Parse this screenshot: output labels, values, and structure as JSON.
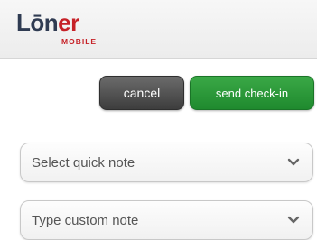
{
  "header": {
    "logo_dark": "Lōn",
    "logo_red": "er",
    "logo_sub": "MOBILE"
  },
  "actions": {
    "cancel_label": "cancel",
    "send_label": "send check-in"
  },
  "notes": {
    "quick_note_label": "Select quick note",
    "custom_note_label": "Type custom note"
  },
  "icons": {
    "dropdown": "chevron-down-icon"
  },
  "colors": {
    "brand_red": "#c62127",
    "brand_dark": "#2f3b52",
    "send_green": "#2a9a3a",
    "cancel_gray": "#555555"
  }
}
